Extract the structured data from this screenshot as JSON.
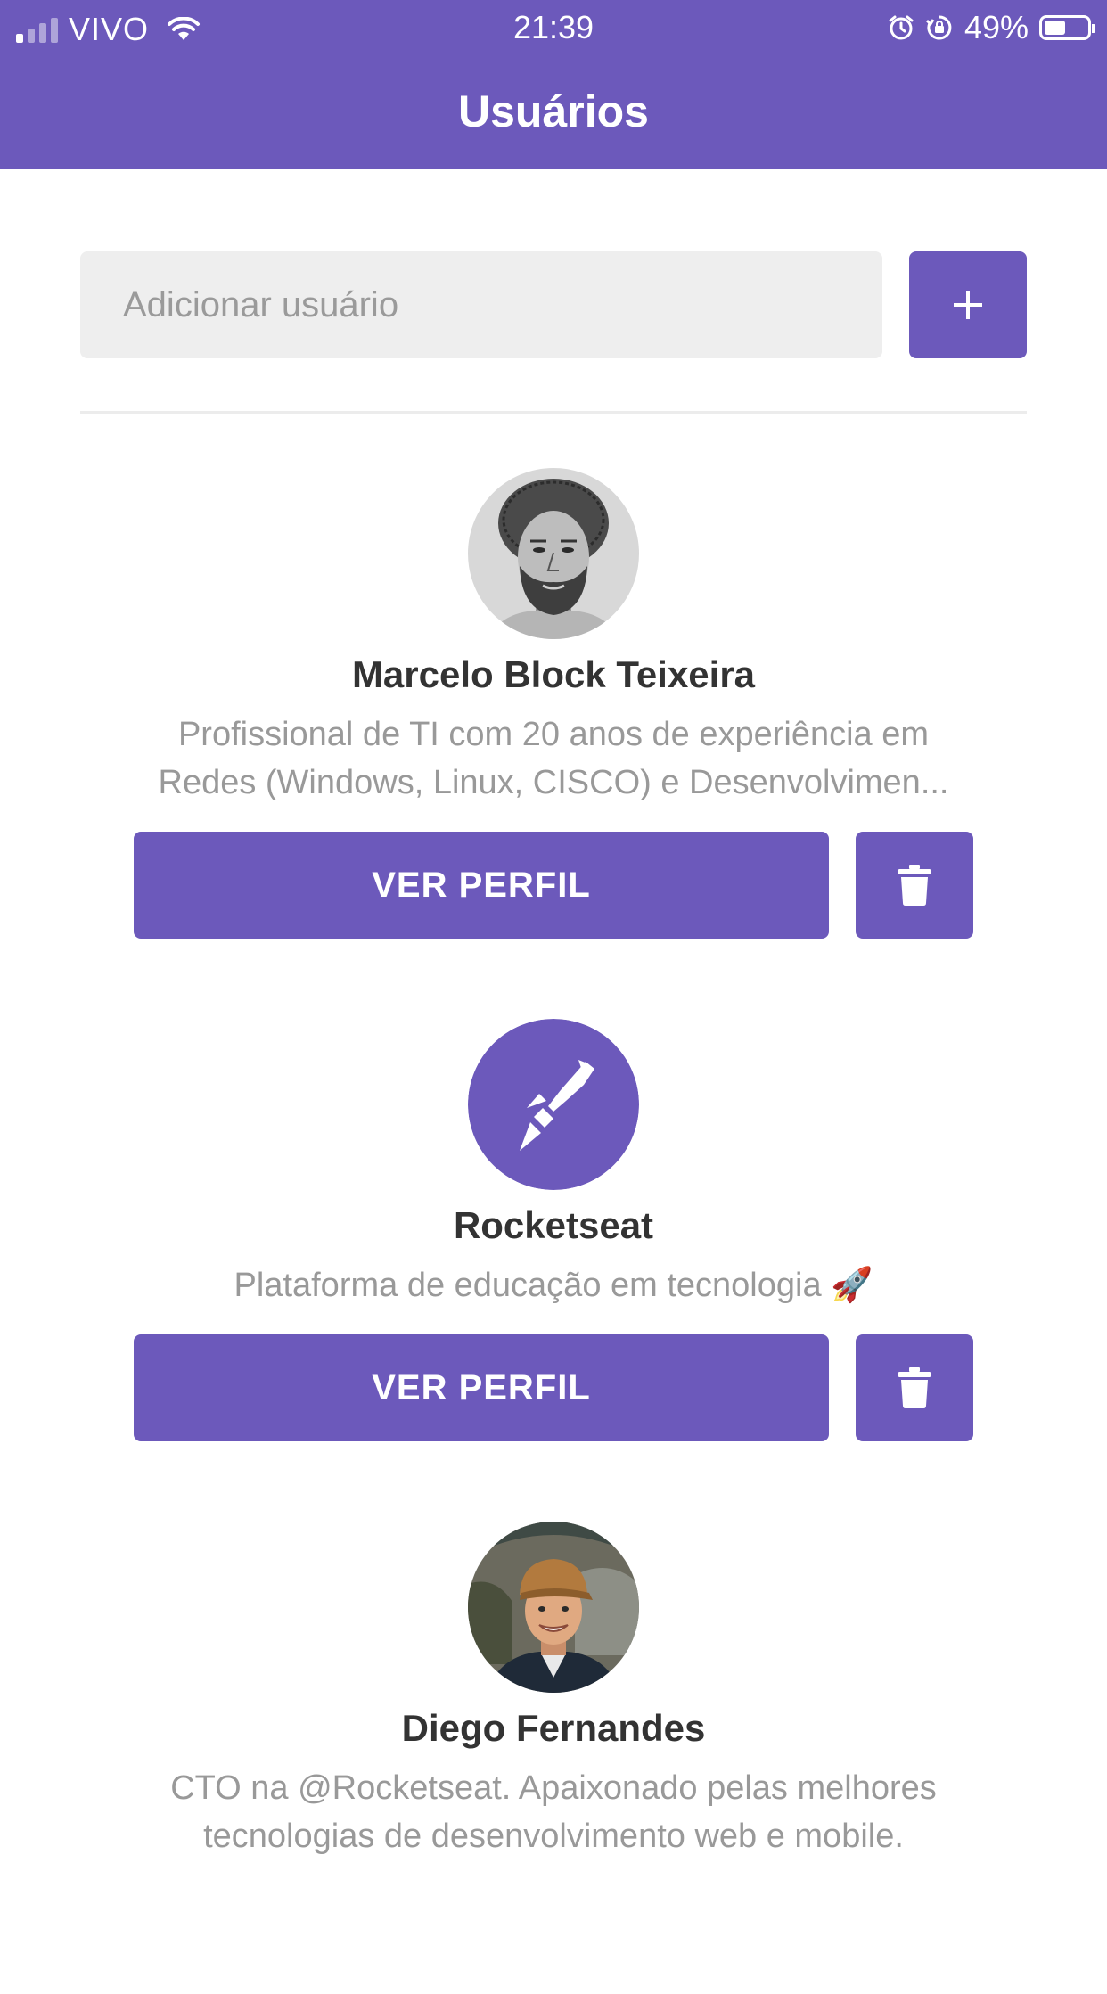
{
  "status_bar": {
    "carrier": "VIVO",
    "time": "21:39",
    "battery": "49%",
    "battery_level": 0.49
  },
  "header": {
    "title": "Usuários"
  },
  "add_user": {
    "placeholder": "Adicionar usuário",
    "value": "",
    "button_icon": "plus-icon"
  },
  "users": [
    {
      "name": "Marcelo Block Teixeira",
      "bio": "Profissional de TI com 20 anos de experiência em\nRedes (Windows, Linux, CISCO) e Desenvolvimen...",
      "avatar": "avatar-sketch-portrait",
      "view_label": "VER PERFIL",
      "delete_icon": "trash-icon"
    },
    {
      "name": "Rocketseat",
      "bio": "Plataforma de educação em tecnologia 🚀",
      "avatar": "rocketseat-logo",
      "view_label": "VER PERFIL",
      "delete_icon": "trash-icon"
    },
    {
      "name": "Diego Fernandes",
      "bio": "CTO na @Rocketseat. Apaixonado pelas melhores\ntecnologias de desenvolvimento web e mobile.",
      "avatar": "avatar-photo-portrait",
      "view_label": "VER PERFIL",
      "delete_icon": "trash-icon"
    }
  ],
  "colors": {
    "primary": "#6c59bb",
    "input_bg": "#eeeeee",
    "name": "#333333",
    "bio": "#999999"
  }
}
